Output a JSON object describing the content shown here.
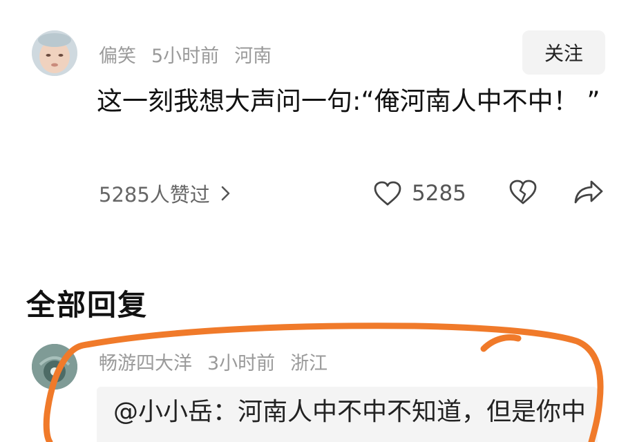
{
  "comment": {
    "username": "偏笑",
    "time": "5小时前",
    "location": "河南",
    "follow_label": "关注",
    "text": "这一刻我想大声问一句:“俺河南人中不中！ ”",
    "likers_label": "5285人赞过",
    "like_count": "5285"
  },
  "section": {
    "title": "全部回复"
  },
  "reply": {
    "username": "畅游四大洋",
    "time": "3小时前",
    "location": "浙江",
    "text": "@小小岳：河南人中不中不知道，但是你中"
  },
  "colors": {
    "highlight": "#f07a2a",
    "meta": "#9a9a9a",
    "text": "#111111"
  },
  "icons": {
    "like": "heart-outline-icon",
    "dislike": "broken-heart-icon",
    "share": "share-arrow-icon",
    "chevron": "chevron-right-icon"
  }
}
